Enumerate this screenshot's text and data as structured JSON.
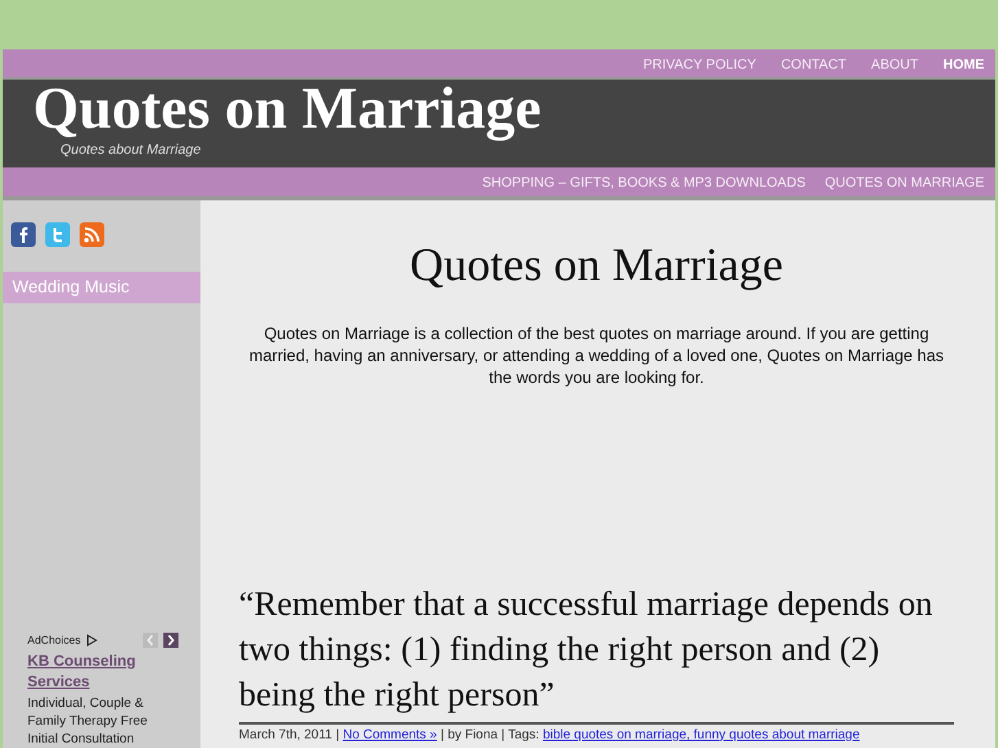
{
  "top_nav": [
    {
      "label": "PRIVACY POLICY",
      "selected": false
    },
    {
      "label": "CONTACT",
      "selected": false
    },
    {
      "label": "ABOUT",
      "selected": false
    },
    {
      "label": "HOME",
      "selected": true
    }
  ],
  "header": {
    "title": "Quotes on Marriage",
    "tagline": "Quotes about Marriage"
  },
  "category_nav": [
    {
      "label": "SHOPPING – GIFTS, BOOKS & MP3 DOWNLOADS"
    },
    {
      "label": "QUOTES ON MARRIAGE"
    }
  ],
  "sidebar": {
    "social": [
      {
        "kind": "facebook"
      },
      {
        "kind": "twitter"
      },
      {
        "kind": "rss"
      }
    ],
    "menu": [
      {
        "label": "Wedding Music"
      }
    ],
    "ad": {
      "label": "AdChoices",
      "title": "KB Counseling Services",
      "text": "Individual, Couple & Family Therapy Free Initial Consultation"
    }
  },
  "main": {
    "title": "Quotes on Marriage",
    "intro": "Quotes on Marriage is a collection of the best quotes on marriage around. If you are getting married, having an anniversary, or attending a wedding of a loved one, Quotes on Marriage has the words you are looking for.",
    "post": {
      "quote": "“Remember that a successful marriage depends on two things: (1) finding the right person and (2) being the right person”",
      "meta": [
        {
          "kind": "text",
          "text": "March 7th, 2011 |"
        },
        {
          "kind": "link",
          "text": "No Comments »"
        },
        {
          "kind": "text",
          "text": "| by Fiona | Tags:"
        },
        {
          "kind": "link",
          "text": "bible quotes on marriage, funny quotes about marriage"
        }
      ]
    }
  }
}
